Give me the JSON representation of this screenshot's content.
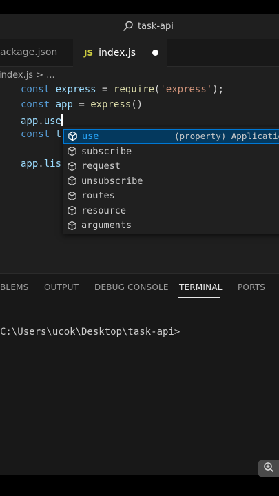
{
  "titlebar": {
    "search_text": "task-api",
    "search_icon": "search-icon"
  },
  "tabs": [
    {
      "label": "ackage.json"
    },
    {
      "label": "index.js",
      "icon_text": "JS",
      "modified": true
    }
  ],
  "breadcrumb": "index.js > ...",
  "code": {
    "line1": {
      "kw": "const",
      "var": "express",
      "op": " = ",
      "fn": "require",
      "p1": "(",
      "str": "'express'",
      "p2": ");"
    },
    "line2": {
      "kw": "const",
      "var": "app",
      "op": " = ",
      "fn": "express",
      "p": "()"
    },
    "line3": {
      "var": "app",
      "dot": ".",
      "method": "use"
    },
    "line4": {
      "kw": "const",
      "var": "t"
    },
    "line5": {
      "var": "app",
      "dot": ".",
      "method": "lis"
    }
  },
  "suggestions": {
    "items": [
      {
        "label": "use",
        "selected": true,
        "detail": "(property) Application"
      },
      {
        "label": "subscribe"
      },
      {
        "label": "request"
      },
      {
        "label": "unsubscribe"
      },
      {
        "label": "routes"
      },
      {
        "label": "resource"
      },
      {
        "label": "arguments"
      }
    ]
  },
  "panel": {
    "tabs": [
      "BLEMS",
      "OUTPUT",
      "DEBUG CONSOLE",
      "TERMINAL",
      "PORTS"
    ],
    "active_tab": "TERMINAL"
  },
  "terminal": {
    "prompt": "C:\\Users\\ucok\\Desktop\\task-api>"
  },
  "colors": {
    "accent": "#0078d4",
    "suggest_highlight": "#2aaaff",
    "keyword": "#569cd6",
    "string": "#ce9178"
  }
}
